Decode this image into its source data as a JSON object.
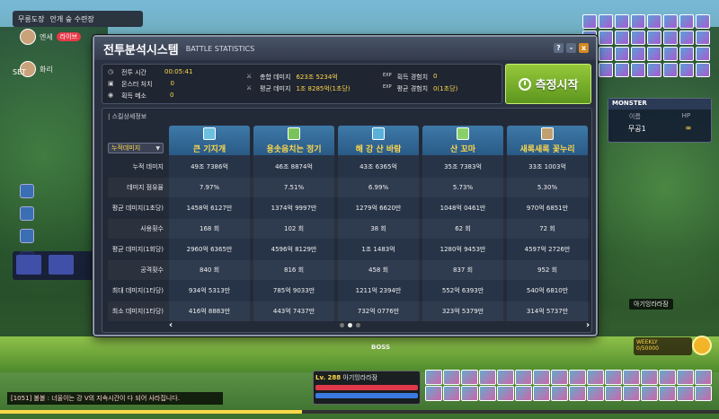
{
  "hud": {
    "location": "무릉도장",
    "location2": "안개 숲 수련장",
    "party": [
      {
        "name": "엔세",
        "badge": "라이브"
      },
      {
        "name": "화리"
      }
    ],
    "set_label": "SET"
  },
  "window": {
    "title": "전투분석시스템",
    "subtitle": "BATTLE STATISTICS",
    "help": "?",
    "minimize": "-",
    "close": "x"
  },
  "summary": {
    "battle_time_label": "전투 시간",
    "battle_time_value": "00:05:41",
    "monster_kill_label": "몬스터 처치",
    "monster_kill_value": "0",
    "meso_label": "획득 메소",
    "meso_value": "0",
    "total_damage_label": "총합 데미지",
    "total_damage_value": "623조 5234억",
    "avg_damage_label": "평균 데미지",
    "avg_damage_value": "1조 8285억(1초당)",
    "exp_gain_label": "획득 경험치",
    "exp_gain_value": "0",
    "avg_exp_label": "평균 경험치",
    "avg_exp_value": "0(1초당)",
    "exp_tag": "EXP"
  },
  "start_button": "측정시작",
  "detail": {
    "section_label": "| 스킬상세정보",
    "sort_option": "누적데미지",
    "skills": [
      {
        "name": "큰 기지개",
        "color": "#6cc0e0"
      },
      {
        "name": "용솟음치는 정기",
        "color": "#7ac35a"
      },
      {
        "name": "해 강 산 바람",
        "color": "#5ab0d8"
      },
      {
        "name": "산 꼬마",
        "color": "#8ad06a"
      },
      {
        "name": "새록새록 꽃누리",
        "color": "#c0a070"
      }
    ],
    "row_labels": [
      "누적 데미지",
      "데미지 점유율",
      "평균 데미지(1초당)",
      "사용횟수",
      "평균 데미지(1회당)",
      "공격횟수",
      "최대 데미지(1타당)",
      "최소 데미지(1타당)"
    ],
    "rows": [
      [
        "49조 7386억",
        "46조 8874억",
        "43조 6365억",
        "35조 7383억",
        "33조 1003억"
      ],
      [
        "7.97%",
        "7.51%",
        "6.99%",
        "5.73%",
        "5.30%"
      ],
      [
        "1458억 6127만",
        "1374억 9997만",
        "1279억 6620만",
        "1048억 0461만",
        "970억 6851만"
      ],
      [
        "168 회",
        "102 회",
        "38 회",
        "62 회",
        "72 회"
      ],
      [
        "2960억 6365만",
        "4596억 8129만",
        "1조 1483억",
        "1280억 9453만",
        "4597억 2726만"
      ],
      [
        "840 회",
        "816 회",
        "458 회",
        "837 회",
        "952 회"
      ],
      [
        "934억 5313만",
        "785억 9033만",
        "1211억 2394만",
        "552억 6393만",
        "540억 6810만"
      ],
      [
        "416억 8883만",
        "443억 7437만",
        "732억 0776만",
        "323억 5379만",
        "314억 5737만"
      ]
    ],
    "prev": "‹",
    "next": "›"
  },
  "monster_panel": {
    "title": "MONSTER",
    "col_name": "이름",
    "col_hp": "HP",
    "name": "무공1",
    "hp": "∞"
  },
  "nameplate": "아기잉라라잠",
  "weekly": {
    "label": "WEEKLY",
    "value": "0/50000"
  },
  "boss_label": "BOSS",
  "chat": "[1051] 볼볼 : 너울이는 강 V의 지속시간이 다 되어 사라집니다.",
  "status": {
    "level": "Lv. 288",
    "name": "아기잉라라잠",
    "hp_label": "HP",
    "mp_label": "MP"
  }
}
